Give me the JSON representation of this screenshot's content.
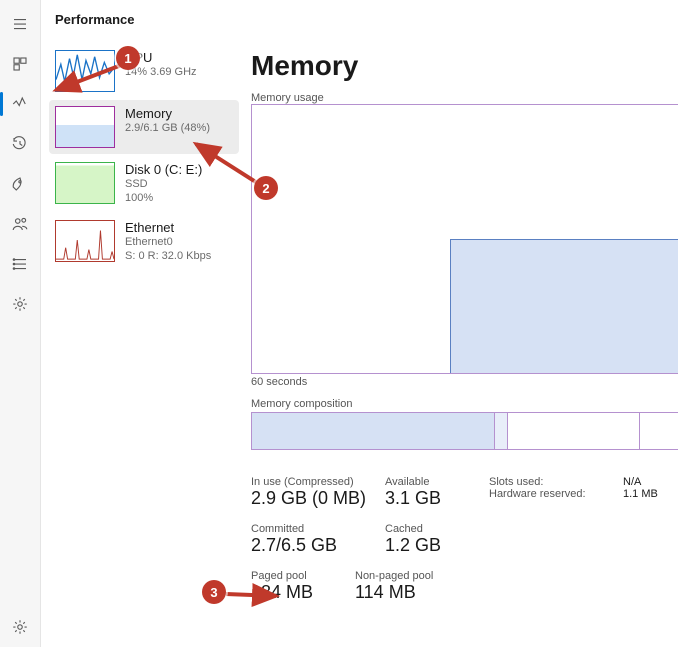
{
  "header": {
    "title": "Performance"
  },
  "sidebar": {
    "items": {
      "cpu": {
        "title": "CPU",
        "sub1": "14%  3.69 GHz"
      },
      "memory": {
        "title": "Memory",
        "sub1": "2.9/6.1 GB (48%)"
      },
      "disk": {
        "title": "Disk 0 (C: E:)",
        "sub1": "SSD",
        "sub2": "100%"
      },
      "eth": {
        "title": "Ethernet",
        "sub1": "Ethernet0",
        "sub2": "S: 0 R: 32.0 Kbps"
      }
    }
  },
  "detail": {
    "title": "Memory",
    "usage_label": "Memory usage",
    "axis_left": "60 seconds",
    "composition_label": "Memory composition",
    "stats": {
      "inuse_label": "In use (Compressed)",
      "inuse_value": "2.9 GB (0 MB)",
      "available_label": "Available",
      "available_value": "3.1 GB",
      "slots_label": "Slots used:",
      "slots_value": "N/A",
      "hwres_label": "Hardware reserved:",
      "hwres_value": "1.1 MB",
      "committed_label": "Committed",
      "committed_value": "2.7/6.5 GB",
      "cached_label": "Cached",
      "cached_value": "1.2 GB",
      "paged_label": "Paged pool",
      "paged_value": "184 MB",
      "nonpaged_label": "Non-paged pool",
      "nonpaged_value": "114 MB"
    }
  },
  "annotations": {
    "n1": "1",
    "n2": "2",
    "n3": "3"
  },
  "chart_data": {
    "type": "area",
    "title": "Memory usage",
    "xlabel": "60 seconds",
    "ylabel": "",
    "ylim_pct": [
      0,
      100
    ],
    "x_seconds": [
      60,
      55,
      50,
      45,
      40,
      35,
      30,
      27,
      25,
      20,
      15,
      10,
      5,
      0
    ],
    "values_pct": [
      0,
      0,
      0,
      0,
      0,
      0,
      0,
      0,
      50,
      50,
      50,
      50,
      50,
      50
    ],
    "note": "Step from ~0% to ~50% around 27s-back; plateau to present.",
    "composition_pct": {
      "in_use": 55,
      "modified": 3,
      "standby": 30,
      "free": 12
    }
  }
}
